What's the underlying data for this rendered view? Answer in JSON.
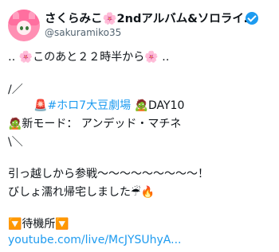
{
  "author": {
    "display_name": "さくらみこ🌸2ndアルバム&ソロライ…",
    "handle": "@sakuramiko35"
  },
  "tweet": {
    "line1": "‥ 🌸このあと２２時半から🌸 ‥",
    "line2": "/／",
    "line3_prefix": "🚨",
    "line3_hashtag": "#ホロ7大豆劇場",
    "line3_suffix": "🧟DAY10",
    "line4": "🧟新モード： アンデッド・マチネ",
    "line5": "\\＼",
    "line6": "引っ越しから参戦〜〜〜〜〜〜〜〜〜！",
    "line7": "びしょ濡れ帰宅しました☔🔥",
    "line8": "🔽待機所🔽",
    "link": "youtube.com/live/McJYSUhyA..."
  },
  "icons": {
    "verified": "verified-badge-icon",
    "avatar": "avatar"
  },
  "colors": {
    "link": "#1d9bf0",
    "verified": "#1d9bf0",
    "text": "#0f1419",
    "secondary": "#536471"
  }
}
